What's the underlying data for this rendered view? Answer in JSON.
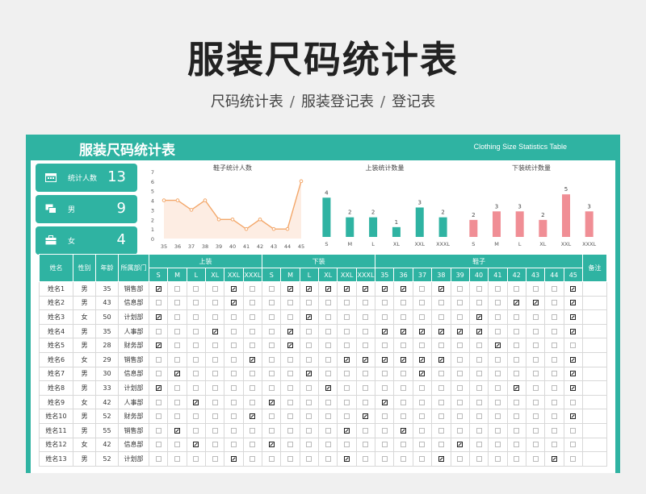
{
  "page": {
    "title": "服装尺码统计表",
    "breadcrumb": [
      "尺码统计表",
      "服装登记表",
      "登记表"
    ]
  },
  "sheet": {
    "title": "服装尺码统计表",
    "subtitle": "Clothing Size Statistics Table"
  },
  "stats": [
    {
      "label": "统计人数",
      "value": "13",
      "icon": "calendar-icon"
    },
    {
      "label": "男",
      "value": "9",
      "icon": "cards-icon"
    },
    {
      "label": "女",
      "value": "4",
      "icon": "briefcase-icon"
    }
  ],
  "colors": {
    "accent": "#2fb3a2",
    "bar_top": "#2fb3a2",
    "bar_bottom": "#f08e95",
    "line": "#f3a76a"
  },
  "chart_data": [
    {
      "type": "area",
      "title": "鞋子统计人数",
      "categories": [
        "35",
        "36",
        "37",
        "38",
        "39",
        "40",
        "41",
        "42",
        "43",
        "44",
        "45"
      ],
      "values": [
        4,
        4,
        3,
        4,
        2,
        2,
        1,
        2,
        1,
        1,
        6
      ],
      "ylim": [
        0,
        7
      ],
      "yticks": [
        "0",
        "1",
        "2",
        "3",
        "4",
        "5",
        "6",
        "7"
      ]
    },
    {
      "type": "bar",
      "title": "上装统计数量",
      "categories": [
        "S",
        "M",
        "L",
        "XL",
        "XXL",
        "XXXL"
      ],
      "values": [
        4,
        2,
        2,
        1,
        3,
        2
      ]
    },
    {
      "type": "bar",
      "title": "下装统计数量",
      "categories": [
        "S",
        "M",
        "L",
        "XL",
        "XXL",
        "XXXL"
      ],
      "values": [
        2,
        3,
        3,
        2,
        5,
        3
      ]
    }
  ],
  "table": {
    "headers": {
      "name": "姓名",
      "gender": "性别",
      "age": "年龄",
      "dept": "所属部门",
      "top": "上装",
      "bottom": "下装",
      "shoes": "鞋子",
      "note": "备注"
    },
    "clothes_sizes": [
      "S",
      "M",
      "L",
      "XL",
      "XXL",
      "XXXL"
    ],
    "shoe_sizes": [
      "35",
      "36",
      "37",
      "38",
      "39",
      "40",
      "41",
      "42",
      "43",
      "44",
      "45"
    ],
    "rows": [
      {
        "name": "姓名1",
        "gender": "男",
        "age": "35",
        "dept": "销售部",
        "top": [
          1,
          0,
          0,
          0,
          1,
          0
        ],
        "bottom": [
          0,
          1,
          1,
          1,
          1,
          1
        ],
        "shoes": [
          1,
          1,
          0,
          1,
          0,
          0,
          0,
          0,
          0,
          0,
          1
        ]
      },
      {
        "name": "姓名2",
        "gender": "男",
        "age": "43",
        "dept": "信息部",
        "top": [
          0,
          0,
          0,
          0,
          1,
          0
        ],
        "bottom": [
          0,
          0,
          0,
          0,
          0,
          0
        ],
        "shoes": [
          0,
          0,
          0,
          0,
          0,
          0,
          0,
          1,
          1,
          0,
          1
        ]
      },
      {
        "name": "姓名3",
        "gender": "女",
        "age": "50",
        "dept": "计划部",
        "top": [
          1,
          0,
          0,
          0,
          0,
          0
        ],
        "bottom": [
          0,
          0,
          1,
          0,
          0,
          0
        ],
        "shoes": [
          0,
          0,
          0,
          0,
          0,
          1,
          0,
          0,
          0,
          0,
          1
        ]
      },
      {
        "name": "姓名4",
        "gender": "男",
        "age": "35",
        "dept": "人事部",
        "top": [
          0,
          0,
          0,
          1,
          0,
          0
        ],
        "bottom": [
          0,
          1,
          0,
          0,
          0,
          0
        ],
        "shoes": [
          1,
          1,
          1,
          1,
          1,
          1,
          0,
          0,
          0,
          0,
          1
        ]
      },
      {
        "name": "姓名5",
        "gender": "男",
        "age": "28",
        "dept": "财务部",
        "top": [
          1,
          0,
          0,
          0,
          0,
          0
        ],
        "bottom": [
          0,
          1,
          0,
          0,
          0,
          0
        ],
        "shoes": [
          0,
          0,
          0,
          0,
          0,
          0,
          1,
          0,
          0,
          0,
          0
        ]
      },
      {
        "name": "姓名6",
        "gender": "女",
        "age": "29",
        "dept": "销售部",
        "top": [
          0,
          0,
          0,
          0,
          0,
          1
        ],
        "bottom": [
          0,
          0,
          0,
          0,
          1,
          1
        ],
        "shoes": [
          1,
          1,
          1,
          1,
          0,
          0,
          0,
          0,
          0,
          0,
          1
        ]
      },
      {
        "name": "姓名7",
        "gender": "男",
        "age": "30",
        "dept": "信息部",
        "top": [
          0,
          1,
          0,
          0,
          0,
          0
        ],
        "bottom": [
          0,
          0,
          1,
          0,
          0,
          0
        ],
        "shoes": [
          0,
          0,
          1,
          0,
          0,
          0,
          0,
          0,
          0,
          0,
          1
        ]
      },
      {
        "name": "姓名8",
        "gender": "男",
        "age": "33",
        "dept": "计划部",
        "top": [
          1,
          0,
          0,
          0,
          0,
          0
        ],
        "bottom": [
          0,
          0,
          0,
          1,
          0,
          0
        ],
        "shoes": [
          0,
          0,
          0,
          0,
          0,
          0,
          0,
          1,
          0,
          0,
          1
        ]
      },
      {
        "name": "姓名9",
        "gender": "女",
        "age": "42",
        "dept": "人事部",
        "top": [
          0,
          0,
          1,
          0,
          0,
          0
        ],
        "bottom": [
          1,
          0,
          0,
          0,
          0,
          0
        ],
        "shoes": [
          1,
          0,
          0,
          0,
          0,
          0,
          0,
          0,
          0,
          0,
          0
        ]
      },
      {
        "name": "姓名10",
        "gender": "男",
        "age": "52",
        "dept": "财务部",
        "top": [
          0,
          0,
          0,
          0,
          0,
          1
        ],
        "bottom": [
          0,
          0,
          0,
          0,
          0,
          1
        ],
        "shoes": [
          0,
          0,
          0,
          0,
          0,
          0,
          0,
          0,
          0,
          0,
          1
        ]
      },
      {
        "name": "姓名11",
        "gender": "男",
        "age": "55",
        "dept": "销售部",
        "top": [
          0,
          1,
          0,
          0,
          0,
          0
        ],
        "bottom": [
          0,
          0,
          0,
          0,
          1,
          0
        ],
        "shoes": [
          0,
          1,
          0,
          0,
          0,
          0,
          0,
          0,
          0,
          0,
          0
        ]
      },
      {
        "name": "姓名12",
        "gender": "女",
        "age": "42",
        "dept": "信息部",
        "top": [
          0,
          0,
          1,
          0,
          0,
          0
        ],
        "bottom": [
          1,
          0,
          0,
          0,
          0,
          0
        ],
        "shoes": [
          0,
          0,
          0,
          0,
          1,
          0,
          0,
          0,
          0,
          0,
          0
        ]
      },
      {
        "name": "姓名13",
        "gender": "男",
        "age": "52",
        "dept": "计划部",
        "top": [
          0,
          0,
          0,
          0,
          1,
          0
        ],
        "bottom": [
          0,
          0,
          0,
          0,
          1,
          0
        ],
        "shoes": [
          0,
          0,
          0,
          1,
          0,
          0,
          0,
          0,
          0,
          1,
          0
        ]
      }
    ]
  }
}
